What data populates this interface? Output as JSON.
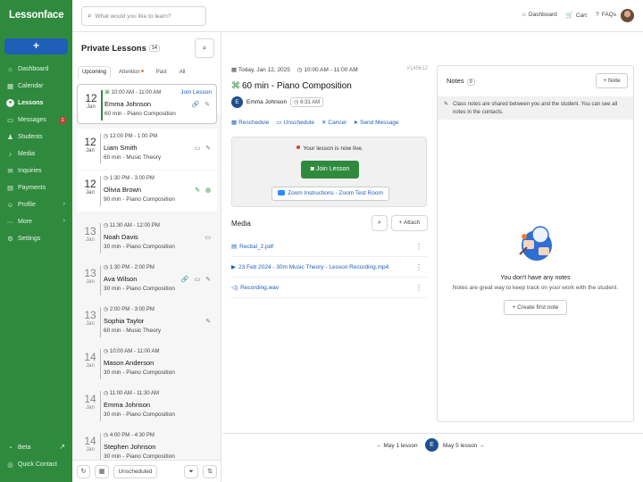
{
  "app": {
    "logo": "Lessonface",
    "new_button": "+"
  },
  "nav": {
    "items": [
      {
        "label": "Dashboard",
        "icon": "home-icon"
      },
      {
        "label": "Calendar",
        "icon": "calendar-icon"
      },
      {
        "label": "Lessons",
        "icon": "lessons-icon",
        "active": true
      },
      {
        "label": "Messages",
        "icon": "messages-icon",
        "badge": "1"
      },
      {
        "label": "Students",
        "icon": "students-icon"
      },
      {
        "label": "Media",
        "icon": "media-icon"
      },
      {
        "label": "Inquiries",
        "icon": "inquiries-icon"
      },
      {
        "label": "Payments",
        "icon": "payments-icon"
      },
      {
        "label": "Profile",
        "icon": "profile-icon",
        "chevron": true
      },
      {
        "label": "More",
        "icon": "more-icon",
        "chevron": true
      },
      {
        "label": "Settings",
        "icon": "gear-icon"
      }
    ],
    "bottom": [
      {
        "label": "Beta",
        "icon": "beta-icon"
      },
      {
        "label": "Quick Contact",
        "icon": "contact-icon"
      }
    ]
  },
  "topbar": {
    "search_placeholder": "What would you like to learn?",
    "dashboard": "Dashboard",
    "cart": "Cart",
    "faqs": "FAQs"
  },
  "lessons": {
    "title": "Private Lessons",
    "count": "14",
    "tabs": [
      "Upcoming",
      "Attention",
      "Past",
      "All"
    ],
    "join_label": "Join Lesson",
    "items": [
      {
        "day": "12",
        "month": "Jan",
        "time": "10:00 AM - 11:00 AM",
        "name": "Emma Johnson",
        "sub": "60 min - Piano Composition",
        "icons": "🔗 ✎"
      },
      {
        "day": "12",
        "month": "Jan",
        "time": "12:00 PM - 1:00 PM",
        "name": "Liam Smith",
        "sub": "60 min - Music Theory",
        "icons": "▭ ✎"
      },
      {
        "day": "12",
        "month": "Jan",
        "time": "1:30 PM - 3:00 PM",
        "name": "Olivia Brown",
        "sub": "90 min - Piano Composition",
        "icons": "✎ ◍"
      },
      {
        "day": "13",
        "month": "Jan",
        "time": "11:30 AM - 12:00 PM",
        "name": "Noah Davis",
        "sub": "30 min - Piano Composition",
        "icons": "▭"
      },
      {
        "day": "13",
        "month": "Jan",
        "time": "1:30 PM - 2:00 PM",
        "name": "Ava Wilson",
        "sub": "30 min - Piano Composition",
        "icons": "🔗 ▭ ✎"
      },
      {
        "day": "13",
        "month": "Jan",
        "time": "2:00 PM - 3:00 PM",
        "name": "Sophia Taylor",
        "sub": "60 min - Music Theory",
        "icons": "✎"
      },
      {
        "day": "14",
        "month": "Jan",
        "time": "10:00 AM - 11:00 AM",
        "name": "Mason Anderson",
        "sub": "30 min - Piano Composition",
        "icons": ""
      },
      {
        "day": "14",
        "month": "Jan",
        "time": "11:00 AM - 11:30 AM",
        "name": "Emma Johnson",
        "sub": "30 min - Piano Composition",
        "icons": ""
      },
      {
        "day": "14",
        "month": "Jan",
        "time": "4:00 PM - 4:30 PM",
        "name": "Stephen Johnson",
        "sub": "30 min - Piano Composition",
        "icons": ""
      }
    ],
    "footer": {
      "unscheduled": "Unscheduled"
    }
  },
  "detail": {
    "date": "Today, Jan 12, 2025",
    "time": "10:00 AM - 11:00 AM",
    "id": "#145612",
    "title": "60 min - Piano Composition",
    "student": "Emma Johnson",
    "student_initial": "E",
    "duration": "6:31 AM",
    "actions": [
      "Reschedule",
      "Unschedule",
      "Cancel",
      "Send Message"
    ],
    "live_text": "Your lesson is now live.",
    "join_button": "Join Lesson",
    "zoom_button": "Zoom Instructions - Zoom Test Room"
  },
  "media": {
    "title": "Media",
    "attach": "Attach",
    "files": [
      {
        "name": "Recital_2.pdf",
        "icon": "file-icon"
      },
      {
        "name": "23 Feb 2024 - 30m Music Theory - Lesson Recording.mp4",
        "icon": "play-icon"
      },
      {
        "name": "Recording.wav",
        "icon": "audio-icon"
      }
    ]
  },
  "pager": {
    "prev": "May 1 lesson",
    "next": "May 5 lesson",
    "initial": "E"
  },
  "notes": {
    "title": "Notes",
    "count": "0",
    "add": "Note",
    "info": "Class notes are shared between you and the student. You can see all notes in the contacts.",
    "empty_title": "You don't have any notes",
    "empty_sub": "Notes are great way to keep track on your work with the student.",
    "create": "Create first note"
  }
}
